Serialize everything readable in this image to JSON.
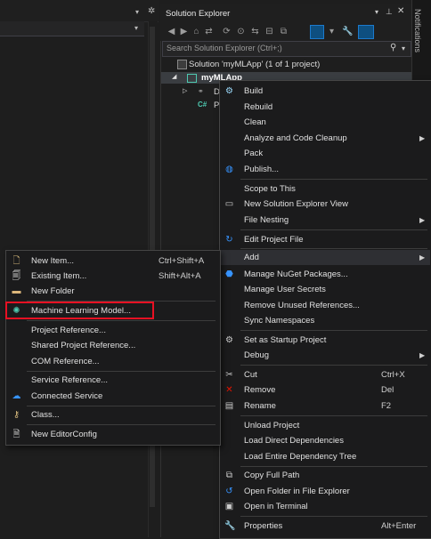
{
  "left_pane": {
    "dropdown_arrow": "chevron-down-icon"
  },
  "solution_explorer": {
    "title": "Solution Explorer",
    "search_placeholder": "Search Solution Explorer (Ctrl+;)",
    "notifications_label": "Notifications",
    "tree": {
      "solution": "Solution 'myMLApp' (1 of 1 project)",
      "project": "myMLApp",
      "dependencies_partial": "D",
      "program_partial": "P"
    }
  },
  "context_menu": {
    "items": [
      {
        "label": "Build",
        "shortcut": "",
        "icon": "build-icon"
      },
      {
        "label": "Rebuild",
        "shortcut": ""
      },
      {
        "label": "Clean",
        "shortcut": ""
      },
      {
        "label": "Analyze and Code Cleanup",
        "submenu": true
      },
      {
        "label": "Pack",
        "shortcut": ""
      },
      {
        "label": "Publish...",
        "shortcut": "",
        "icon": "globe-icon"
      },
      {
        "label": "Scope to This",
        "shortcut": ""
      },
      {
        "label": "New Solution Explorer View",
        "shortcut": "",
        "icon": "window-icon"
      },
      {
        "label": "File Nesting",
        "submenu": true
      },
      {
        "label": "Edit Project File",
        "shortcut": "",
        "icon": "edit-icon"
      },
      {
        "label": "Add",
        "submenu": true
      },
      {
        "label": "Manage NuGet Packages...",
        "icon": "nuget-icon"
      },
      {
        "label": "Manage User Secrets"
      },
      {
        "label": "Remove Unused References..."
      },
      {
        "label": "Sync Namespaces"
      },
      {
        "label": "Set as Startup Project",
        "icon": "gear-icon"
      },
      {
        "label": "Debug",
        "submenu": true
      },
      {
        "label": "Cut",
        "shortcut": "Ctrl+X",
        "icon": "scissors-icon"
      },
      {
        "label": "Remove",
        "shortcut": "Del",
        "icon": "close-icon"
      },
      {
        "label": "Rename",
        "shortcut": "F2",
        "icon": "rename-icon"
      },
      {
        "label": "Unload Project"
      },
      {
        "label": "Load Direct Dependencies"
      },
      {
        "label": "Load Entire Dependency Tree"
      },
      {
        "label": "Copy Full Path",
        "icon": "copy-icon"
      },
      {
        "label": "Open Folder in File Explorer",
        "icon": "folder-icon"
      },
      {
        "label": "Open in Terminal",
        "icon": "terminal-icon"
      },
      {
        "label": "Properties",
        "shortcut": "Alt+Enter",
        "icon": "wrench-icon"
      }
    ]
  },
  "add_submenu": {
    "items": [
      {
        "label": "New Item...",
        "shortcut": "Ctrl+Shift+A",
        "icon": "new-item-icon"
      },
      {
        "label": "Existing Item...",
        "shortcut": "Shift+Alt+A",
        "icon": "existing-item-icon"
      },
      {
        "label": "New Folder",
        "shortcut": "",
        "icon": "folder-icon"
      },
      {
        "label": "Machine Learning Model...",
        "shortcut": "",
        "icon": "ml-model-icon"
      },
      {
        "label": "Project Reference...",
        "shortcut": ""
      },
      {
        "label": "Shared Project Reference...",
        "shortcut": ""
      },
      {
        "label": "COM Reference...",
        "shortcut": ""
      },
      {
        "label": "Service Reference...",
        "shortcut": ""
      },
      {
        "label": "Connected Service",
        "shortcut": "",
        "icon": "cloud-icon"
      },
      {
        "label": "Class...",
        "shortcut": "",
        "icon": "class-icon"
      },
      {
        "label": "New EditorConfig",
        "shortcut": "",
        "icon": "document-icon"
      }
    ]
  }
}
